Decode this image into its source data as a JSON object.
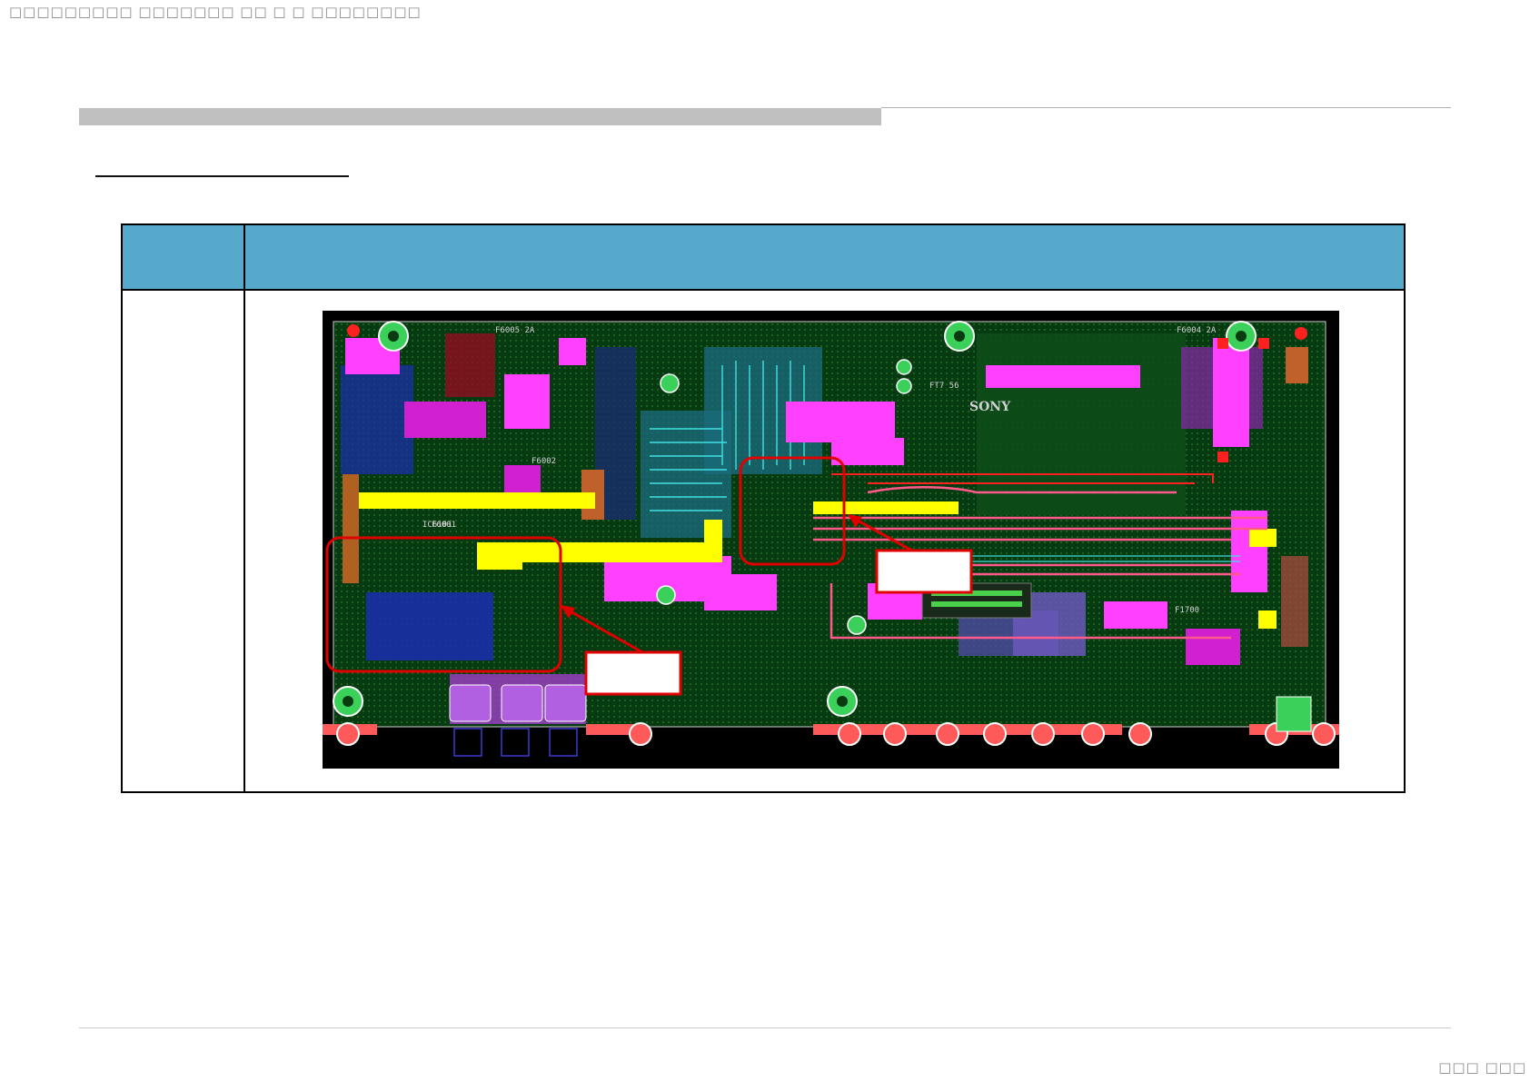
{
  "header": {
    "text": "□□□□□□□□□ □□□□□□□ □□ □ □ □□□□□□□□"
  },
  "footer": {
    "text": "□□□ □□□"
  },
  "pcb": {
    "silkscreen": {
      "ref_top_left": "F6005 2A",
      "ref_top_right": "F6004 2A",
      "ref_mid_left": "F6001",
      "ref_mid": "F6002",
      "brand": "SONY",
      "ref_lower_left": "IC6101",
      "ref_lower_right": "F1700",
      "ref_small": "FT7 56"
    }
  },
  "colors": {
    "table_header": "#56a9cb",
    "board": "#063a10",
    "trace_yellow": "#ffff00",
    "trace_magenta": "#ff40ff",
    "trace_cyan": "#40e0e0",
    "highlight_red": "#e00000",
    "pad_salmon": "#ff5a5a"
  }
}
